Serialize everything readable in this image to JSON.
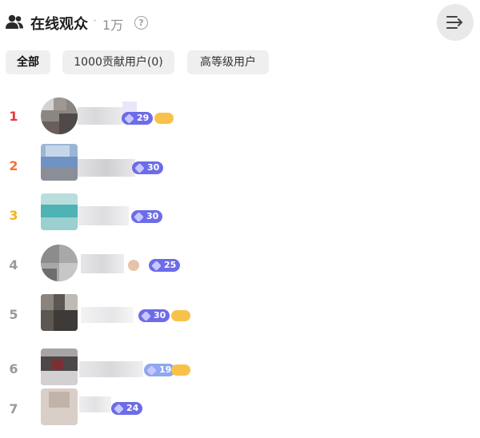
{
  "header": {
    "title": "在线观众",
    "separator": "·",
    "viewer_count": "1万",
    "help": "?"
  },
  "tabs": [
    {
      "label": "全部",
      "active": true
    },
    {
      "label": "1000贡献用户(0)",
      "active": false
    },
    {
      "label": "高等级用户",
      "active": false
    }
  ],
  "viewers": [
    {
      "rank": "1",
      "rank_color": "#e53a3a",
      "level": "29",
      "fan_badge": ""
    },
    {
      "rank": "2",
      "rank_color": "#f0743a",
      "level": "30",
      "fan_badge": ""
    },
    {
      "rank": "3",
      "rank_color": "#f2b418",
      "level": "30",
      "fan_badge": ""
    },
    {
      "rank": "4",
      "rank_color": "#9a9a9a",
      "level": "25",
      "fan_badge": ""
    },
    {
      "rank": "5",
      "rank_color": "#9a9a9a",
      "level": "30",
      "fan_badge": ""
    },
    {
      "rank": "6",
      "rank_color": "#9a9a9a",
      "level": "19",
      "fan_badge": ""
    },
    {
      "rank": "7",
      "rank_color": "#9a9a9a",
      "level": "24",
      "fan_badge": ""
    }
  ],
  "colors": {
    "level_badge": "#6c6ce8",
    "fan_badge": "#f8c24a",
    "tab_bg": "#efefef"
  }
}
